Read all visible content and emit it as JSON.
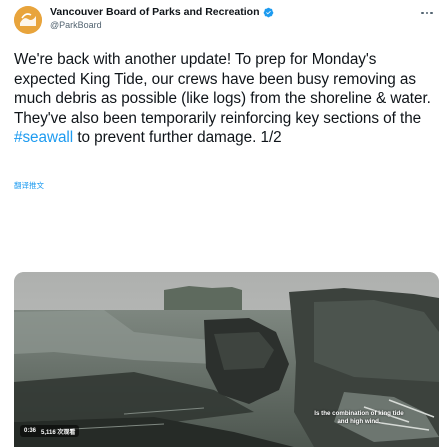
{
  "author": {
    "name": "Vancouver Board of Parks and Recreation",
    "handle": "@ParkBoard",
    "verified": true,
    "avatar_icon": "parkboard-logo-icon"
  },
  "tweet": {
    "text_before": "We're back with another update! To prep for Monday's expected King Tide, our crews have been busy removing as much debris as possible (like logs) from the shoreline & water. They've also been temporarily reinforcing key sections of the ",
    "hashtag": "#seawall",
    "text_after": " to prevent further damage. 1/2",
    "translate_label": "翻译推文"
  },
  "media": {
    "type": "video",
    "caption_line1": "Is the combination of king tide",
    "caption_line2": "and high wind.",
    "time": "0:36",
    "views": "5,116 次观看"
  },
  "colors": {
    "link": "#1d9bf0",
    "text": "#0f1419",
    "secondary": "#536471",
    "verified": "#1d9bf0"
  }
}
